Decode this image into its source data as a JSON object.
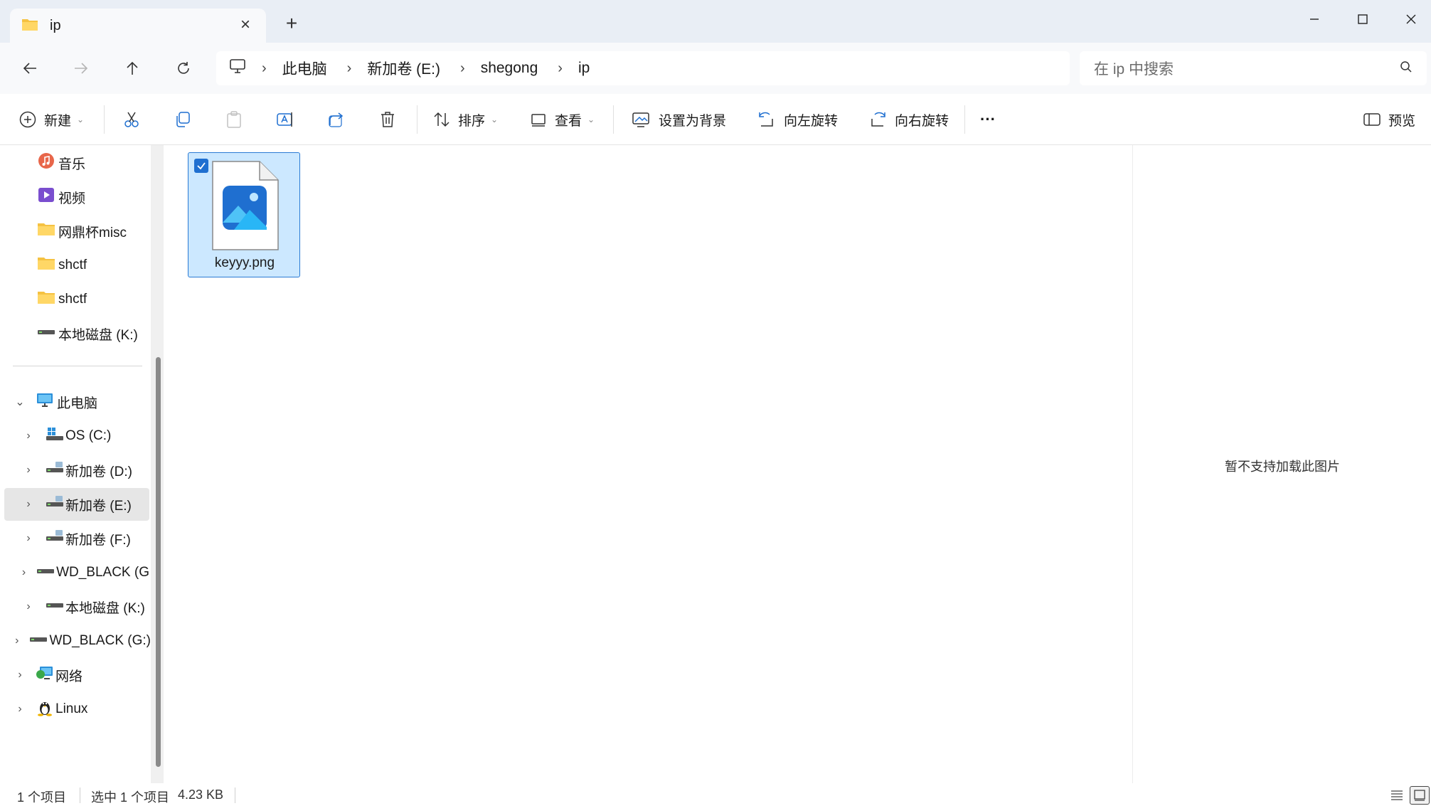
{
  "tab": {
    "title": "ip",
    "close_label": "×",
    "new_tab_label": "+"
  },
  "address": {
    "crumbs": [
      "此电脑",
      "新加卷 (E:)",
      "shegong",
      "ip"
    ],
    "separator": "›"
  },
  "search": {
    "placeholder": "在 ip 中搜索"
  },
  "toolbar": {
    "new_label": "新建",
    "sort_label": "排序",
    "view_label": "查看",
    "set_background_label": "设置为背景",
    "rotate_left_label": "向左旋转",
    "rotate_right_label": "向右旋转",
    "more_label": "···",
    "preview_label": "预览"
  },
  "sidebar": {
    "quick_access": [
      {
        "label": "音乐",
        "icon": "music-icon",
        "pinned": true
      },
      {
        "label": "视频",
        "icon": "video-icon",
        "pinned": true
      },
      {
        "label": "网鼎杯misc",
        "icon": "folder-icon",
        "pinned": true
      },
      {
        "label": "shctf",
        "icon": "folder-icon",
        "pinned": true
      },
      {
        "label": "shctf",
        "icon": "folder-icon",
        "pinned": true
      },
      {
        "label": "本地磁盘 (K:)",
        "icon": "drive-icon",
        "pinned": true
      }
    ],
    "this_pc": {
      "label": "此电脑",
      "icon": "monitor-icon",
      "expanded": true
    },
    "drives": [
      {
        "label": "OS (C:)",
        "icon": "os-drive-icon"
      },
      {
        "label": "新加卷 (D:)",
        "icon": "drive-icon"
      },
      {
        "label": "新加卷 (E:)",
        "icon": "drive-icon",
        "selected": true
      },
      {
        "label": "新加卷 (F:)",
        "icon": "drive-icon"
      },
      {
        "label": "WD_BLACK (G",
        "icon": "drive-icon"
      },
      {
        "label": "本地磁盘 (K:)",
        "icon": "drive-icon"
      }
    ],
    "root_items": [
      {
        "label": "WD_BLACK (G:)",
        "icon": "drive-icon"
      },
      {
        "label": "网络",
        "icon": "network-icon"
      },
      {
        "label": "Linux",
        "icon": "linux-icon"
      }
    ]
  },
  "files": [
    {
      "name": "keyyy.png",
      "icon": "image-file-icon",
      "selected": true
    }
  ],
  "preview": {
    "message": "暂不支持加载此图片"
  },
  "status": {
    "item_count": "1 个项目",
    "selected": "选中 1 个项目",
    "size": "4.23 KB"
  },
  "colors": {
    "accent": "#1f6fd0",
    "selection_bg": "#cce8ff",
    "titlebar_bg": "#e9eef5",
    "folder": "#f5c242"
  }
}
